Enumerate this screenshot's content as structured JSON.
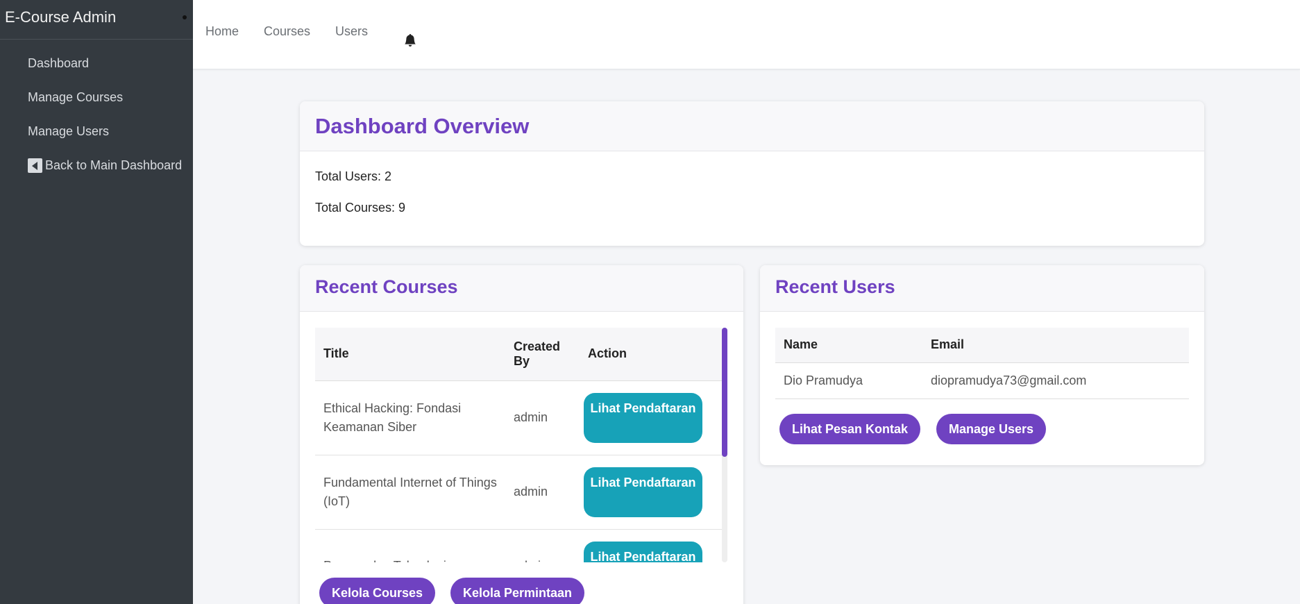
{
  "sidebar": {
    "brand": "E-Course Admin",
    "items": [
      {
        "label": "Dashboard"
      },
      {
        "label": "Manage Courses"
      },
      {
        "label": "Manage Users"
      },
      {
        "label": "Back to Main Dashboard",
        "icon": "caret-left-square-icon"
      }
    ]
  },
  "topnav": {
    "links": [
      "Home",
      "Courses",
      "Users"
    ],
    "notification_icon": "bell-icon"
  },
  "overview": {
    "title": "Dashboard Overview",
    "total_users": "Total Users: 2",
    "total_courses": "Total Courses: 9"
  },
  "recent_courses": {
    "title": "Recent Courses",
    "columns": [
      "Title",
      "Created By",
      "Action"
    ],
    "rows": [
      {
        "title": "Ethical Hacking: Fondasi Keamanan Siber",
        "created_by": "admin",
        "action": "Lihat Pendaftaran"
      },
      {
        "title": "Fundamental Internet of Things (IoT)",
        "created_by": "admin",
        "action": "Lihat Pendaftaran"
      },
      {
        "title": "Pengenalan Teknologi",
        "created_by": "admin",
        "action": "Lihat Pendaftaran"
      }
    ],
    "buttons": [
      "Kelola Courses",
      "Kelola Permintaan"
    ]
  },
  "recent_users": {
    "title": "Recent Users",
    "columns": [
      "Name",
      "Email"
    ],
    "rows": [
      {
        "name": "Dio Pramudya",
        "email": "diopramudya73@gmail.com"
      }
    ],
    "buttons": [
      "Lihat Pesan Kontak",
      "Manage Users"
    ]
  },
  "colors": {
    "accent": "#6f42c1",
    "teal": "#17a2b8",
    "sidebar": "#343a40"
  }
}
